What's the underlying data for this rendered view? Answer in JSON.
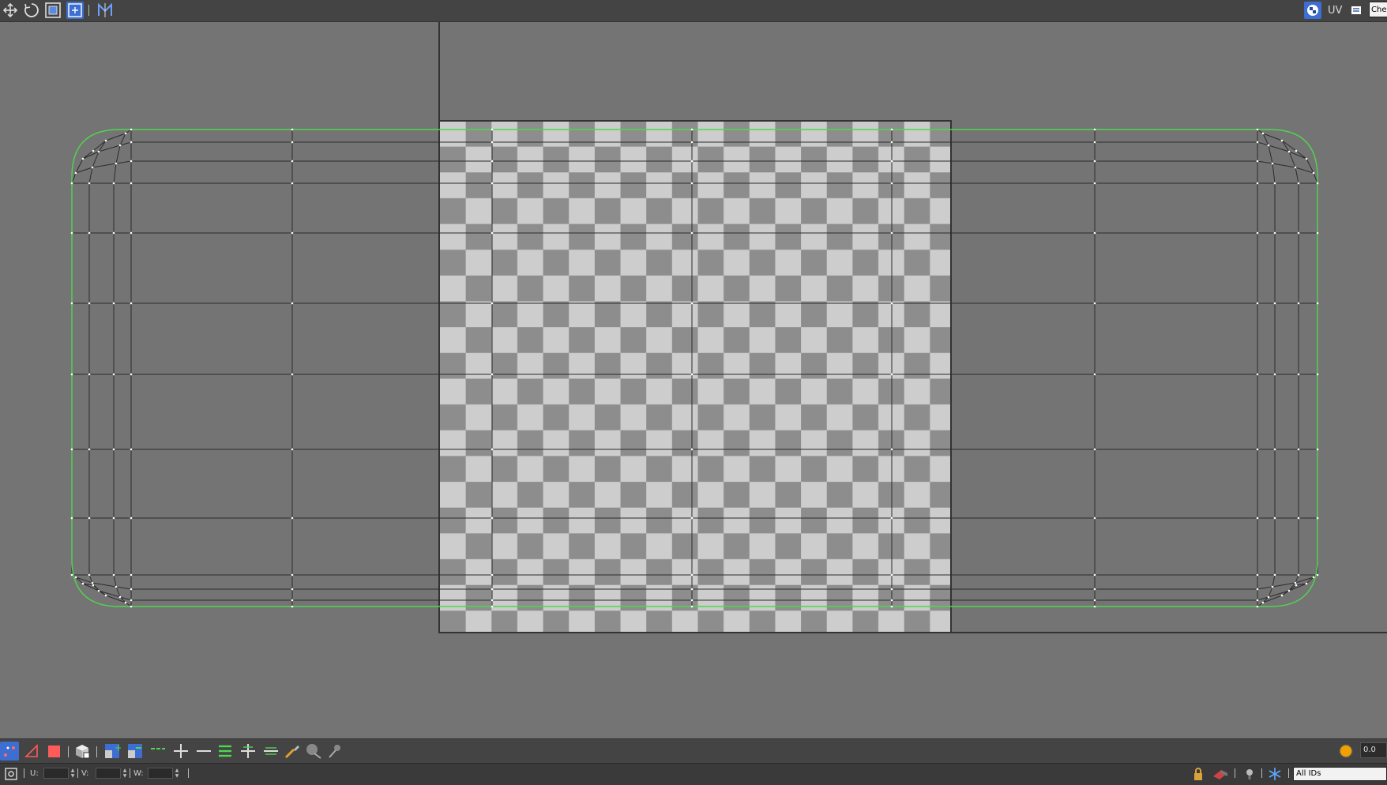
{
  "toolbar": {
    "tools": [
      {
        "name": "move-icon",
        "active": false
      },
      {
        "name": "rotate-icon",
        "active": false
      },
      {
        "name": "scale-icon",
        "active": false
      },
      {
        "name": "freeform-icon",
        "active": true
      },
      {
        "name": "mirror-icon",
        "active": false
      }
    ],
    "right": {
      "texture_icon": "checker-texture-icon",
      "uv_label": "UV",
      "options_icon": "list-options-icon",
      "texture_dropdown": "Che"
    }
  },
  "viewport": {
    "background_color": "#747474",
    "checker_colors": {
      "light": "#cdcdcd",
      "dark": "#8d8d8d"
    },
    "mesh_outline_color": "#4fd64f",
    "mesh_edge_color": "#2b2b2b",
    "vertex_color": "#ffffff"
  },
  "bottom_toolbar": {
    "tools": [
      {
        "name": "vertex-select-icon",
        "active": true
      },
      {
        "name": "edge-select-icon",
        "active": false
      },
      {
        "name": "polygon-select-icon",
        "active": false
      },
      {
        "name": "select-by-element-icon",
        "active": false
      },
      {
        "name": "grow-selection-icon",
        "active": false
      },
      {
        "name": "shrink-selection-icon",
        "active": false
      },
      {
        "name": "loop-icon",
        "active": false
      },
      {
        "name": "loop-grow-icon",
        "active": false
      },
      {
        "name": "loop-shrink-icon",
        "active": false
      },
      {
        "name": "ring-icon",
        "active": false
      },
      {
        "name": "ring-grow-icon",
        "active": false
      },
      {
        "name": "ring-shrink-icon",
        "active": false
      },
      {
        "name": "paint-select-icon",
        "active": false
      },
      {
        "name": "brush-size-up-icon",
        "active": false
      },
      {
        "name": "brush-size-down-icon",
        "active": false
      }
    ],
    "soft_select_value": "0.0"
  },
  "status_bar": {
    "u_label": "U:",
    "v_label": "V:",
    "w_label": "W:",
    "u_value": "",
    "v_value": "",
    "w_value": "",
    "id_filter": "All IDs"
  }
}
